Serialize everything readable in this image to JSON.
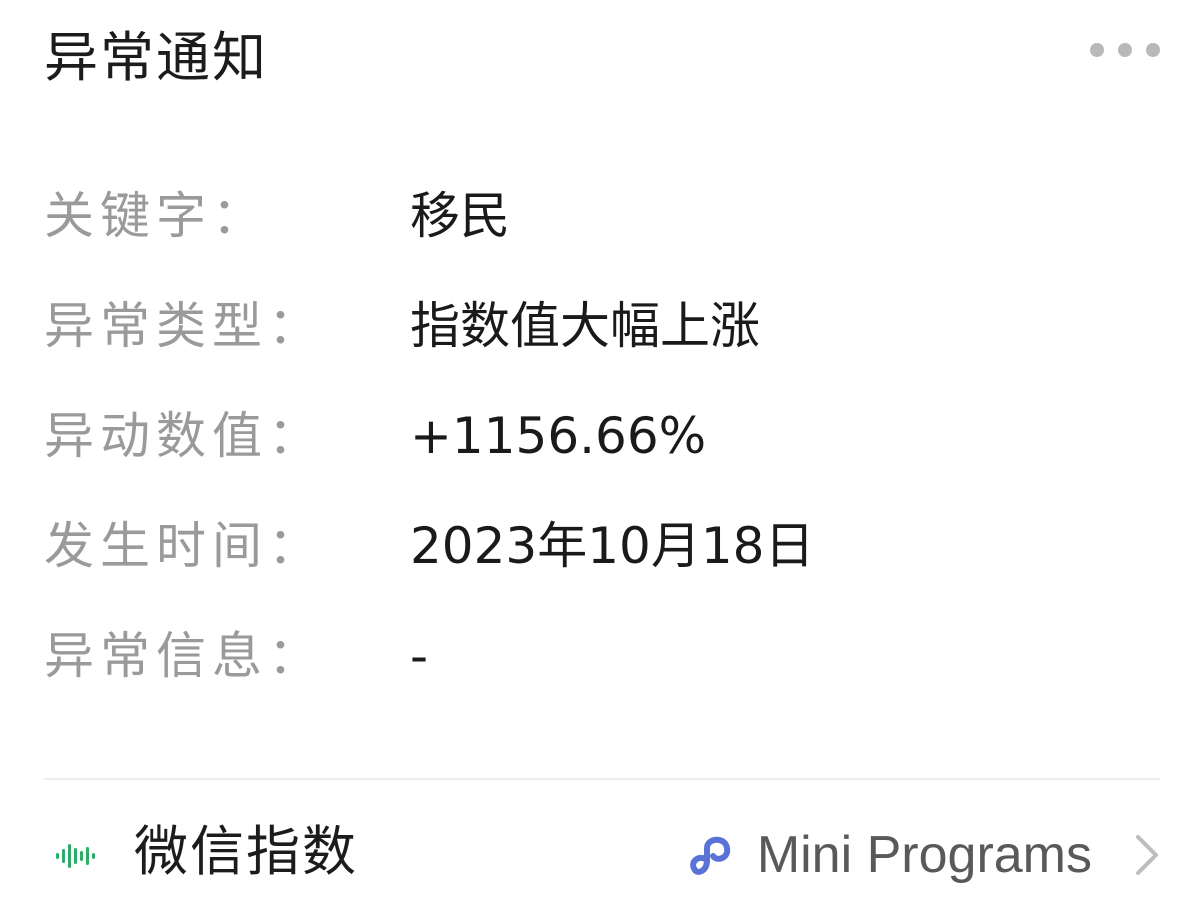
{
  "header": {
    "title": "异常通知",
    "more_icon": "more-horizontal-icon"
  },
  "details": [
    {
      "label": "关键字：",
      "value": "移民"
    },
    {
      "label": "异常类型：",
      "value": "指数值大幅上涨"
    },
    {
      "label": "异动数值：",
      "value": "+1156.66%"
    },
    {
      "label": "发生时间：",
      "value": "2023年10月18日"
    },
    {
      "label": "异常信息：",
      "value": "-"
    }
  ],
  "footer": {
    "brand_icon": "wechat-index-icon",
    "brand_name": "微信指数",
    "mini_program_icon": "mini-program-icon",
    "mini_program_label": "Mini Programs",
    "chevron_icon": "chevron-right-icon",
    "colors": {
      "brand_icon": "#2aae67",
      "mini_program_icon": "#5a72d6"
    }
  }
}
